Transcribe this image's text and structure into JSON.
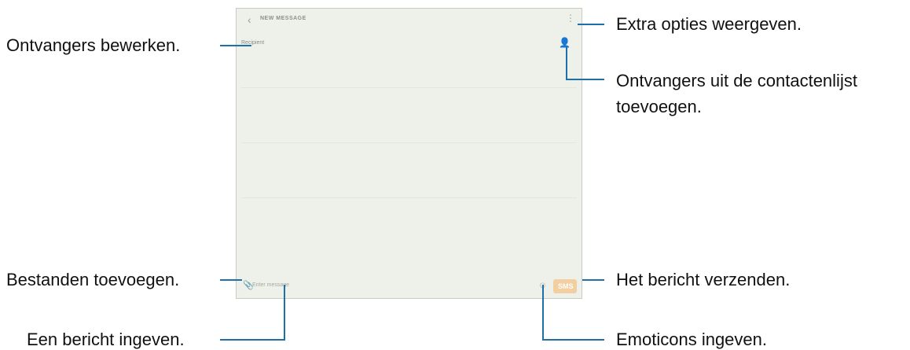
{
  "screen": {
    "back_icon": "‹",
    "title": "NEW MESSAGE",
    "more_icon": "⋮",
    "recipients_placeholder": "Recipient",
    "contact_icon": "👤",
    "attach_icon": "📎",
    "message_placeholder": "Enter message",
    "emoji_icon": "☺",
    "send_label": "SMS"
  },
  "callouts": {
    "edit_recipients": "Ontvangers bewerken.",
    "add_files": "Bestanden toevoegen.",
    "enter_message": "Een bericht ingeven.",
    "extra_options": "Extra opties weergeven.",
    "contacts_line1": "Ontvangers uit de contactenlijst",
    "contacts_line2": "toevoegen.",
    "send_message": "Het bericht verzenden.",
    "enter_emoticons": "Emoticons ingeven."
  },
  "colors": {
    "callout_line": "#1f6fa8",
    "send_button": "#f2cfa0"
  }
}
